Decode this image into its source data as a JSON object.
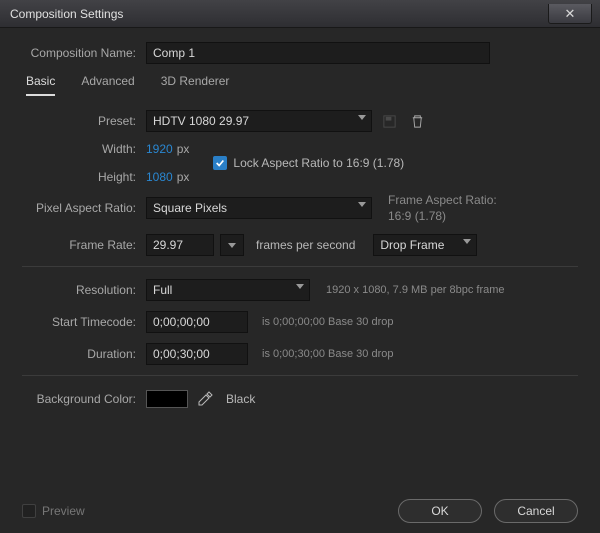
{
  "window": {
    "title": "Composition Settings"
  },
  "compName": {
    "label": "Composition Name:",
    "value": "Comp 1"
  },
  "tabs": {
    "basic": "Basic",
    "advanced": "Advanced",
    "renderer": "3D Renderer"
  },
  "preset": {
    "label": "Preset:",
    "value": "HDTV 1080 29.97"
  },
  "dimensions": {
    "widthLabel": "Width:",
    "widthValue": "1920",
    "heightLabel": "Height:",
    "heightValue": "1080",
    "unit": "px",
    "lockLabel": "Lock Aspect Ratio to 16:9 (1.78)"
  },
  "par": {
    "label": "Pixel Aspect Ratio:",
    "value": "Square Pixels",
    "frameAspectLabel": "Frame Aspect Ratio:",
    "frameAspectValue": "16:9 (1.78)"
  },
  "frameRate": {
    "label": "Frame Rate:",
    "value": "29.97",
    "unit": "frames per second",
    "dropValue": "Drop Frame"
  },
  "resolution": {
    "label": "Resolution:",
    "value": "Full",
    "hint": "1920 x 1080, 7.9 MB per 8bpc frame"
  },
  "startTC": {
    "label": "Start Timecode:",
    "value": "0;00;00;00",
    "hint": "is 0;00;00;00  Base 30  drop"
  },
  "duration": {
    "label": "Duration:",
    "value": "0;00;30;00",
    "hint": "is 0;00;30;00  Base 30  drop"
  },
  "bg": {
    "label": "Background Color:",
    "name": "Black"
  },
  "footer": {
    "preview": "Preview",
    "ok": "OK",
    "cancel": "Cancel"
  }
}
